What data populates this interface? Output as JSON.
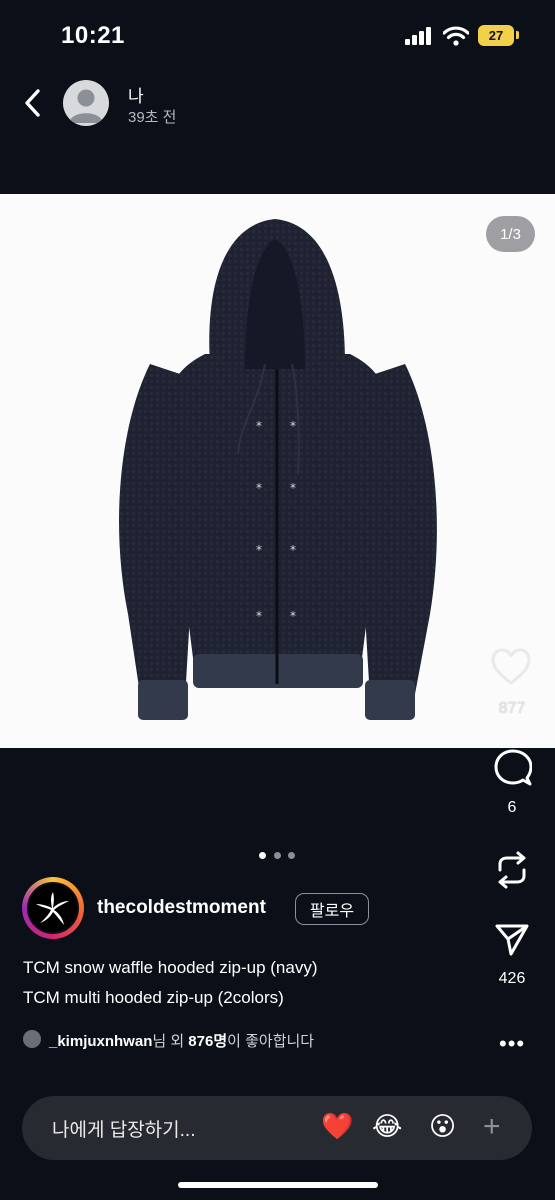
{
  "status": {
    "time": "10:21",
    "battery": "27"
  },
  "header": {
    "username": "나",
    "timeago": "39초 전"
  },
  "post": {
    "image_counter": "1/3",
    "carousel": {
      "current": 1,
      "total": 3
    },
    "likes_count": "877",
    "comments_count": "6",
    "shares_count": "426",
    "account": "thecoldestmoment",
    "follow_label": "팔로우",
    "caption_line1": "TCM snow waffle hooded zip-up (navy)",
    "caption_line2": "TCM multi hooded zip-up (2colors)",
    "liked_by_user": "_kimjuxnhwan",
    "liked_by_mid": "님 외 ",
    "liked_by_count": "876명",
    "liked_by_end": "이 좋아합니다"
  },
  "reply": {
    "placeholder": "나에게 답장하기...",
    "quick_reactions": [
      "❤️",
      "😂",
      "😮"
    ],
    "plus": "+"
  },
  "icons": [
    "back-chevron-icon",
    "heart-icon",
    "comment-icon",
    "repost-icon",
    "send-icon",
    "more-icon"
  ]
}
